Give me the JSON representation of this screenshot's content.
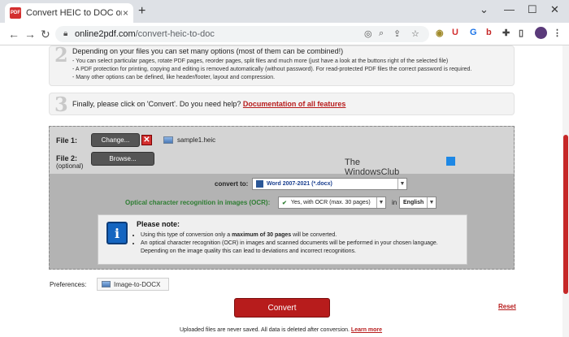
{
  "browser": {
    "tab_title": "Convert HEIC to DOC online & f",
    "tab_favicon_text": "PDF",
    "close_tab": "×",
    "new_tab": "+",
    "url_host": "online2pdf.com",
    "url_path": "/convert-heic-to-doc",
    "window_controls": [
      "⌄",
      "—",
      "☐",
      "✕"
    ],
    "extensions": [
      "U",
      "G",
      "b"
    ]
  },
  "steps": {
    "step2": {
      "number": "2",
      "title": "Depending on your files you can set many options (most of them can be combined!)",
      "bullets": [
        "- You can select particular pages, rotate PDF pages, reorder pages, split files and much more (just have a look at the buttons right of the selected file)",
        "- A PDF protection for printing, copying and editing is removed automatically (without password). For read-protected PDF files the correct password is required.",
        "- Many other options can be defined, like header/footer, layout and compression."
      ]
    },
    "step3": {
      "number": "3",
      "text": "Finally, please click on 'Convert'. Do you need help?",
      "link": "Documentation of all features"
    }
  },
  "upload": {
    "file1_label": "File 1:",
    "file1_button": "Change...",
    "file1_delete": "✕",
    "file1_name": "sample1.heic",
    "file2_label": "File 2:",
    "file2_optional": "(optional)",
    "file2_button": "Browse..."
  },
  "watermark": {
    "line1": "The",
    "line2": "WindowsClub"
  },
  "convert_to": {
    "label": "convert to:",
    "value": "Word 2007-2021 (*.docx)"
  },
  "ocr": {
    "label": "Optical character recognition in images (OCR):",
    "value": "Yes, with OCR (max. 30 pages)",
    "in_label": "in",
    "language": "English"
  },
  "note": {
    "icon": "i",
    "title": "Please note:",
    "bullet1_pre": "Using this type of conversion only a ",
    "bullet1_bold": "maximum of 30 pages",
    "bullet1_post": " will be converted.",
    "bullet2": "An optical character recognition (OCR) in images and scanned documents will be performed in your chosen language. Depending on the image quality this can lead to deviations and incorrect recognitions."
  },
  "preferences": {
    "label": "Preferences:",
    "button": "Image-to-DOCX"
  },
  "actions": {
    "convert": "Convert",
    "reset": "Reset"
  },
  "footer": {
    "text": "Uploaded files are never saved. All data is deleted after conversion.",
    "link": "Learn more"
  },
  "colors": {
    "brand_red": "#b71c1c",
    "ocr_green": "#2e7d32"
  }
}
